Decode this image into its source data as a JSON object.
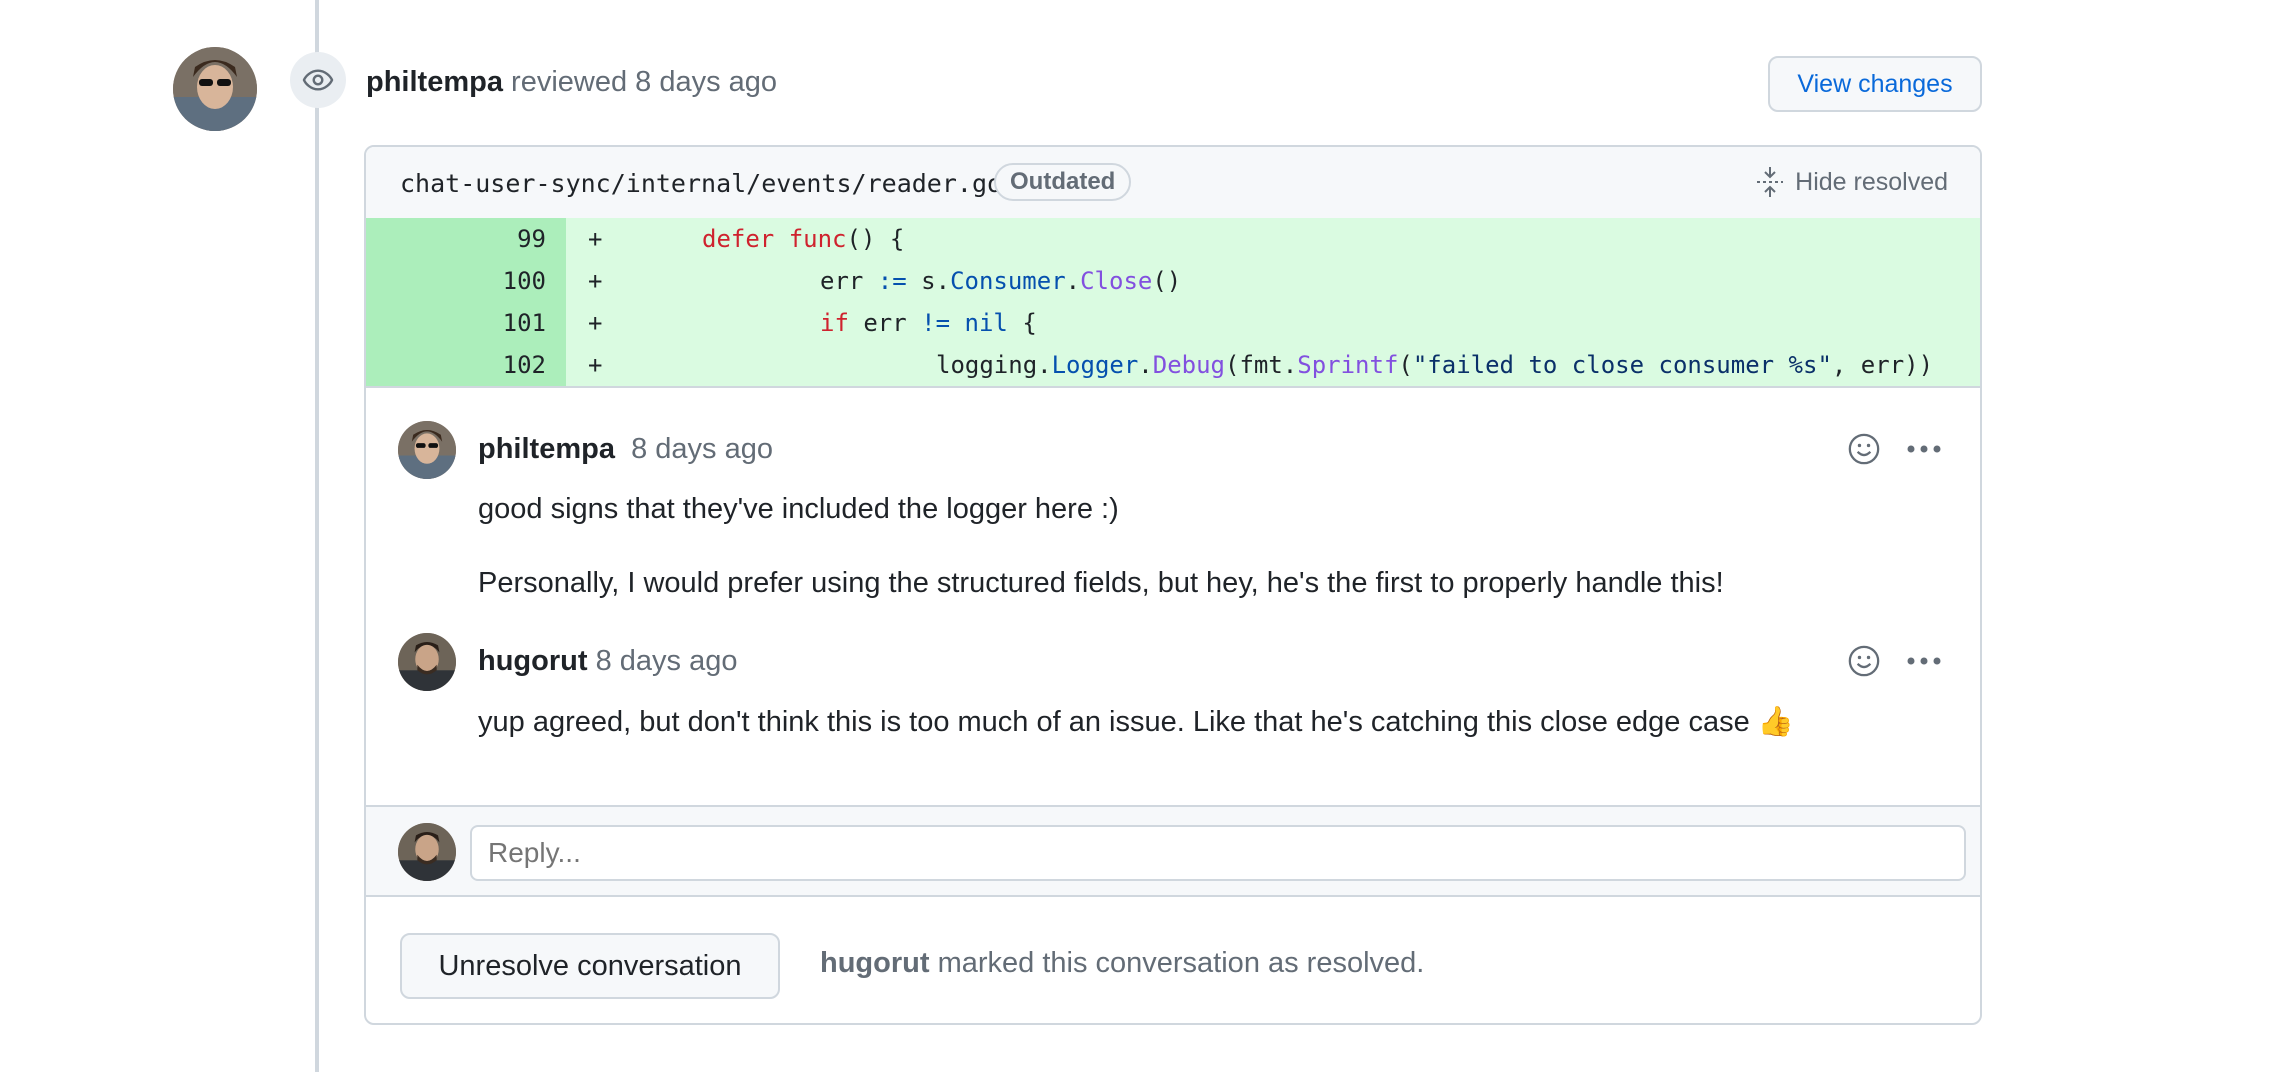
{
  "review": {
    "author": "philtempa",
    "action": "reviewed",
    "time": "8 days ago",
    "view_changes_label": "View changes",
    "icon": "eye-icon"
  },
  "file": {
    "path": "chat-user-sync/internal/events/reader.go",
    "badge": "Outdated",
    "hide_resolved_label": "Hide resolved"
  },
  "code_lines": [
    {
      "num": "99",
      "marker": "+"
    },
    {
      "num": "100",
      "marker": "+"
    },
    {
      "num": "101",
      "marker": "+"
    },
    {
      "num": "102",
      "marker": "+"
    }
  ],
  "code_tokens": {
    "l99": [
      "defer",
      " ",
      "func",
      "() {"
    ],
    "l100": [
      "err ",
      ":=",
      " s.",
      "Consumer",
      ".",
      "Close",
      "()"
    ],
    "l101": [
      "if",
      " err ",
      "!=",
      " ",
      "nil",
      " {"
    ],
    "l102": [
      "logging.",
      "Logger",
      ".",
      "Debug",
      "(fmt.",
      "Sprintf",
      "(",
      "\"failed to close consumer %s\"",
      ", err))"
    ]
  },
  "comments": [
    {
      "author": "philtempa",
      "time": "8 days ago",
      "body": [
        "good signs that they've included the logger here :)",
        "Personally, I would prefer using the structured fields, but hey, he's the first to properly handle this!"
      ]
    },
    {
      "author": "hugorut",
      "time": "8 days ago",
      "body": [
        "yup agreed, but don't think this is too much of an issue. Like that he's catching this close edge case 👍"
      ]
    }
  ],
  "reply": {
    "placeholder": "Reply..."
  },
  "resolution": {
    "button_label": "Unresolve conversation",
    "actor": "hugorut",
    "message": " marked this conversation as resolved."
  },
  "colors": {
    "addition_bg": "#dafbe1",
    "addition_num_bg": "#aceebb",
    "link": "#0969da",
    "muted": "#636c76",
    "border": "#d0d7de"
  }
}
